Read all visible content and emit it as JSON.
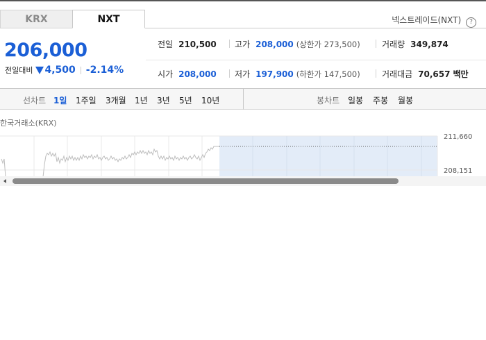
{
  "tabs": [
    {
      "label": "KRX",
      "active": false
    },
    {
      "label": "NXT",
      "active": true
    }
  ],
  "exchange_name": "넥스트레이드(NXT)",
  "help_icon": "?",
  "price": {
    "current": "206,000",
    "change_label": "전일대비",
    "change_direction": "down",
    "change_amount": "4,500",
    "change_percent": "-2.14%"
  },
  "info": {
    "prev_close": {
      "label": "전일",
      "value": "210,500"
    },
    "high": {
      "label": "고가",
      "value": "208,000",
      "limit_label": "상한가",
      "limit_value": "273,500"
    },
    "volume": {
      "label": "거래량",
      "value": "349,874"
    },
    "open": {
      "label": "시가",
      "value": "208,000"
    },
    "low": {
      "label": "저가",
      "value": "197,900",
      "limit_label": "하한가",
      "limit_value": "147,500"
    },
    "trade_value": {
      "label": "거래대금",
      "value": "70,657",
      "unit": "백만"
    }
  },
  "toolbar": {
    "line_chart_label": "선차트",
    "line_periods": [
      "1일",
      "1주일",
      "3개월",
      "1년",
      "3년",
      "5년",
      "10년"
    ],
    "line_active": "1일",
    "candle_chart_label": "봉차트",
    "candle_periods": [
      "일봉",
      "주봉",
      "월봉"
    ]
  },
  "chart": {
    "title": "한국거래소(KRX)",
    "y_labels": [
      "211,660",
      "208,151"
    ]
  },
  "colors": {
    "accent_blue": "#1b5fd6",
    "chart_future_fill": "#e3ecf8",
    "line": "#bdbdbd"
  }
}
